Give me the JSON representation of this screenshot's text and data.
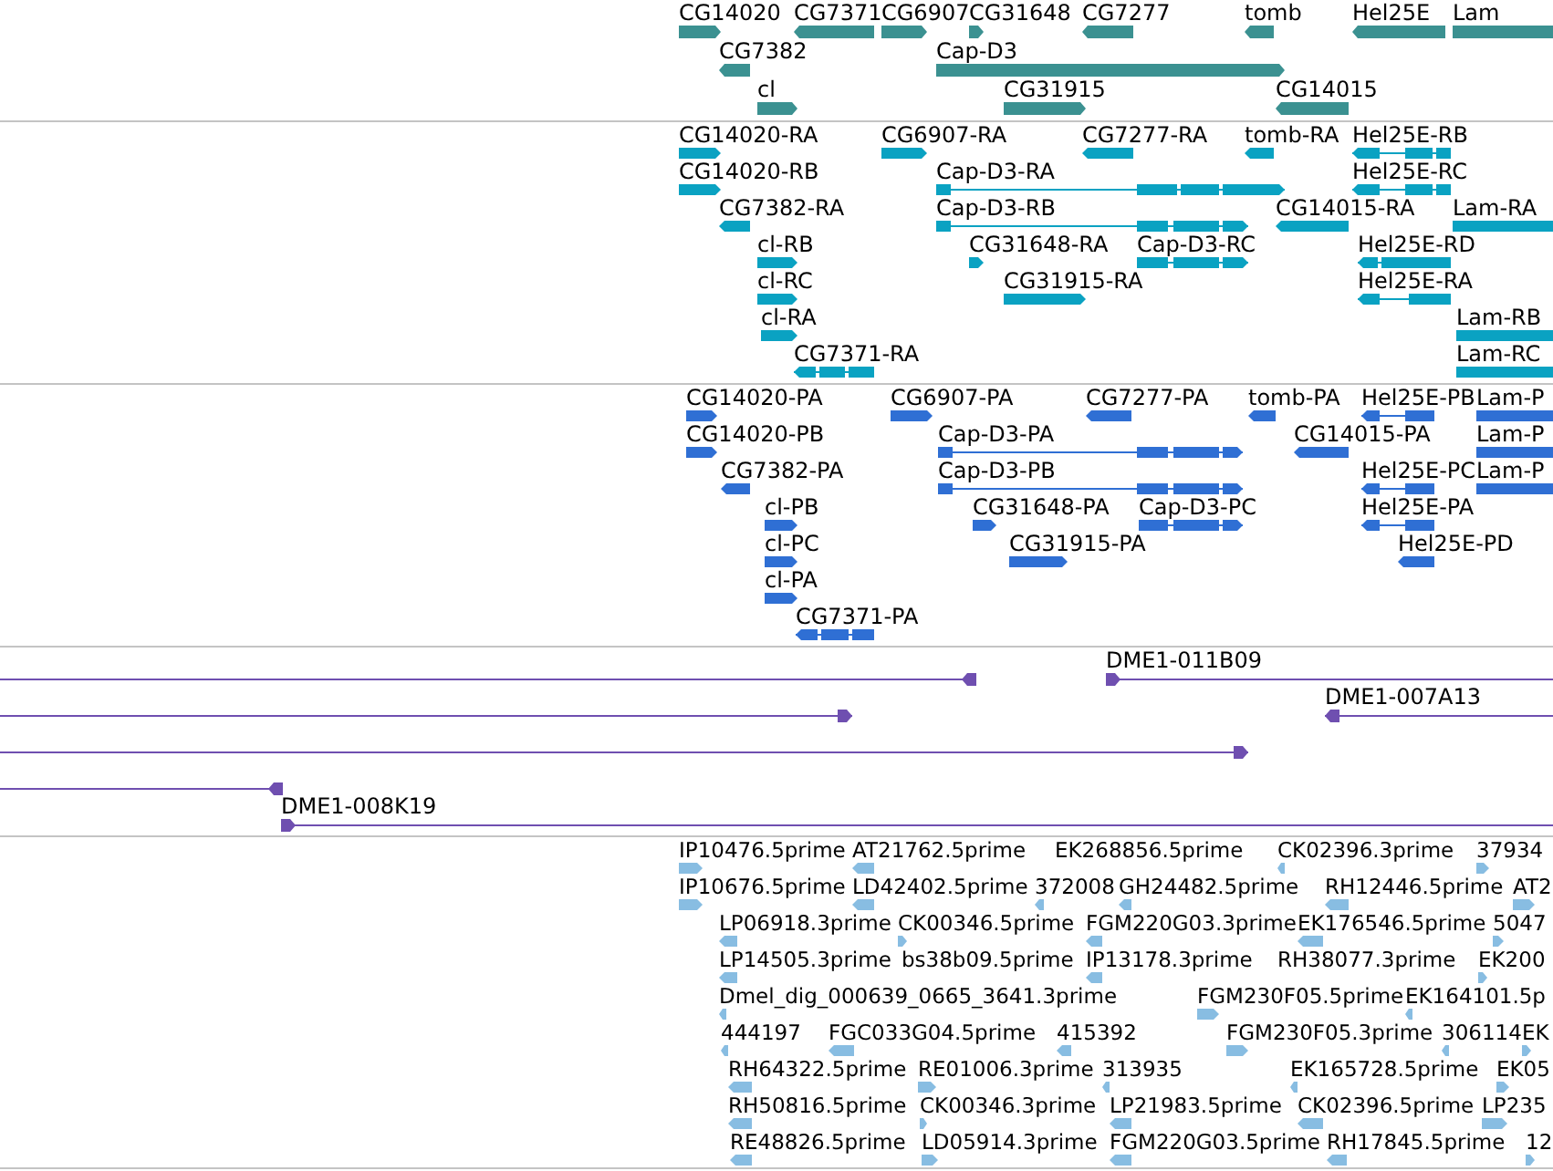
{
  "tracks": [
    {
      "kind": "gene",
      "features": [
        {
          "label": "CG14020",
          "reverse": false
        },
        {
          "label": "CG7371",
          "reverse": true
        },
        {
          "label": "CG6907",
          "reverse": false
        },
        {
          "label": "CG31648",
          "reverse": false
        },
        {
          "label": "CG7277",
          "reverse": true
        },
        {
          "label": "tomb",
          "reverse": true
        },
        {
          "label": "Hel25E",
          "reverse": true
        },
        {
          "label": "Lam",
          "reverse": false
        },
        {
          "label": "CG7382",
          "reverse": true
        },
        {
          "label": "Cap-D3",
          "reverse": false
        },
        {
          "label": "cl",
          "reverse": false
        },
        {
          "label": "CG31915",
          "reverse": false
        },
        {
          "label": "CG14015",
          "reverse": true
        }
      ]
    },
    {
      "kind": "transcript",
      "features": [
        {
          "label": "CG14020-RA",
          "reverse": false
        },
        {
          "label": "CG6907-RA",
          "reverse": false
        },
        {
          "label": "CG7277-RA",
          "reverse": true
        },
        {
          "label": "tomb-RA",
          "reverse": true
        },
        {
          "label": "Hel25E-RB",
          "reverse": true
        },
        {
          "label": "CG14020-RB",
          "reverse": false
        },
        {
          "label": "Cap-D3-RA",
          "reverse": false
        },
        {
          "label": "Hel25E-RC",
          "reverse": true
        },
        {
          "label": "CG7382-RA",
          "reverse": true
        },
        {
          "label": "Cap-D3-RB",
          "reverse": false
        },
        {
          "label": "CG14015-RA",
          "reverse": true
        },
        {
          "label": "Lam-RA",
          "reverse": false
        },
        {
          "label": "cl-RB",
          "reverse": false
        },
        {
          "label": "CG31648-RA",
          "reverse": false
        },
        {
          "label": "Cap-D3-RC",
          "reverse": false
        },
        {
          "label": "Hel25E-RD",
          "reverse": true
        },
        {
          "label": "cl-RC",
          "reverse": false
        },
        {
          "label": "CG31915-RA",
          "reverse": false
        },
        {
          "label": "Hel25E-RA",
          "reverse": true
        },
        {
          "label": "cl-RA",
          "reverse": false
        },
        {
          "label": "Lam-RB",
          "reverse": false
        },
        {
          "label": "CG7371-RA",
          "reverse": true
        },
        {
          "label": "Lam-RC",
          "reverse": false
        }
      ]
    },
    {
      "kind": "protein",
      "features": [
        {
          "label": "CG14020-PA",
          "reverse": false
        },
        {
          "label": "CG6907-PA",
          "reverse": false
        },
        {
          "label": "CG7277-PA",
          "reverse": true
        },
        {
          "label": "tomb-PA",
          "reverse": true
        },
        {
          "label": "Hel25E-PB",
          "reverse": true
        },
        {
          "label": "Lam-P",
          "reverse": false
        },
        {
          "label": "CG14020-PB",
          "reverse": false
        },
        {
          "label": "Cap-D3-PA",
          "reverse": false
        },
        {
          "label": "CG14015-PA",
          "reverse": true
        },
        {
          "label": "Lam-P",
          "reverse": false
        },
        {
          "label": "CG7382-PA",
          "reverse": true
        },
        {
          "label": "Cap-D3-PB",
          "reverse": false
        },
        {
          "label": "Hel25E-PC",
          "reverse": true
        },
        {
          "label": "Lam-P",
          "reverse": false
        },
        {
          "label": "cl-PB",
          "reverse": false
        },
        {
          "label": "CG31648-PA",
          "reverse": false
        },
        {
          "label": "Cap-D3-PC",
          "reverse": false
        },
        {
          "label": "Hel25E-PA",
          "reverse": true
        },
        {
          "label": "cl-PC",
          "reverse": false
        },
        {
          "label": "CG31915-PA",
          "reverse": false
        },
        {
          "label": "Hel25E-PD",
          "reverse": true
        },
        {
          "label": "cl-PA",
          "reverse": false
        },
        {
          "label": "CG7371-PA",
          "reverse": true
        }
      ]
    },
    {
      "kind": "clone",
      "features": [
        {
          "reverse": true
        },
        {
          "label": "DME1-011B09",
          "reverse": false
        },
        {
          "reverse": false
        },
        {
          "label": "DME1-007A13",
          "reverse": true
        },
        {
          "reverse": false
        },
        {
          "reverse": true
        },
        {
          "label": "DME1-008K19",
          "reverse": false
        }
      ]
    },
    {
      "kind": "est",
      "features": [
        {
          "label": "IP10476.5prime",
          "reverse": false
        },
        {
          "label": "AT21762.5prime",
          "reverse": true
        },
        {
          "label": "EK268856.5prime"
        },
        {
          "label": "CK02396.3prime",
          "reverse": true
        },
        {
          "label": "37934",
          "reverse": false
        },
        {
          "label": "IP10676.5prime",
          "reverse": false
        },
        {
          "label": "LD42402.5prime",
          "reverse": true
        },
        {
          "label": "372008",
          "reverse": true
        },
        {
          "label": "GH24482.5prime",
          "reverse": true
        },
        {
          "label": "RH12446.5prime",
          "reverse": true
        },
        {
          "label": "AT2",
          "reverse": false
        },
        {
          "label": "LP06918.3prime",
          "reverse": true
        },
        {
          "label": "CK00346.5prime",
          "reverse": false
        },
        {
          "label": "FGM220G03.3prime",
          "reverse": true
        },
        {
          "label": "EK176546.5prime",
          "reverse": true
        },
        {
          "label": "5047",
          "reverse": false
        },
        {
          "label": "LP14505.3prime",
          "reverse": true
        },
        {
          "label": "bs38b09.5prime"
        },
        {
          "label": "IP13178.3prime",
          "reverse": true
        },
        {
          "label": "RH38077.3prime"
        },
        {
          "label": "EK200",
          "reverse": false
        },
        {
          "label": "Dmel_dig_000639_0665_3641.3prime",
          "reverse": true
        },
        {
          "label": "FGM230F05.5prime",
          "reverse": false
        },
        {
          "label": "EK164101.5p",
          "reverse": true
        },
        {
          "label": "444197",
          "reverse": true
        },
        {
          "label": "FGC033G04.5prime",
          "reverse": true
        },
        {
          "label": "415392",
          "reverse": true
        },
        {
          "label": "FGM230F05.3prime",
          "reverse": false
        },
        {
          "label": "306114",
          "reverse": true
        },
        {
          "label": "EK",
          "reverse": false
        },
        {
          "label": "RH64322.5prime",
          "reverse": true
        },
        {
          "label": "RE01006.3prime",
          "reverse": false
        },
        {
          "label": "313935",
          "reverse": true
        },
        {
          "label": "EK165728.5prime",
          "reverse": true
        },
        {
          "label": "EK05",
          "reverse": false
        },
        {
          "label": "RH50816.5prime",
          "reverse": true
        },
        {
          "label": "CK00346.3prime",
          "reverse": false
        },
        {
          "label": "LP21983.5prime",
          "reverse": true
        },
        {
          "label": "CK02396.5prime",
          "reverse": true
        },
        {
          "label": "LP235",
          "reverse": false
        },
        {
          "label": "RE48826.5prime",
          "reverse": true
        },
        {
          "label": "LD05914.3prime",
          "reverse": false
        },
        {
          "label": "FGM220G03.5prime",
          "reverse": true
        },
        {
          "label": "RH17845.5prime",
          "reverse": true
        },
        {
          "label": "12",
          "reverse": false
        }
      ]
    }
  ]
}
